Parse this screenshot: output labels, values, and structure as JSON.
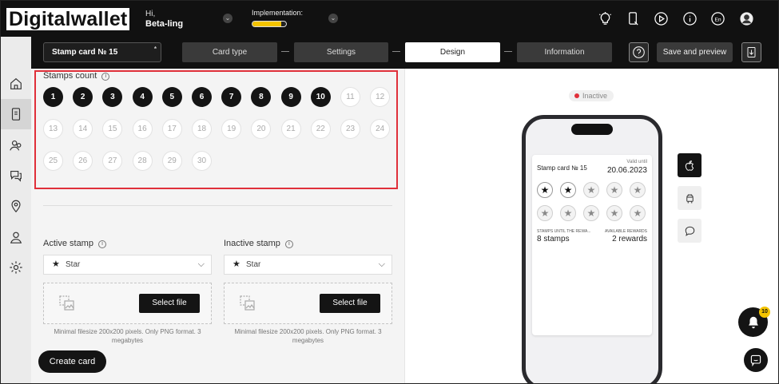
{
  "header": {
    "logo": "Digitalwallet",
    "greeting": "Hi,",
    "user_name": "Beta-ling",
    "implementation_label": "Implementation:",
    "implementation_progress": 0.85,
    "language": "En",
    "icons": [
      "lightbulb-icon",
      "phone-icon",
      "play-icon",
      "info-icon",
      "language-icon",
      "avatar"
    ]
  },
  "sidebar": {
    "items": [
      "home-icon",
      "card-icon",
      "users-icon",
      "chat-icon",
      "location-icon",
      "user-icon",
      "settings-icon"
    ],
    "active_index": 1
  },
  "toolbar": {
    "card_name": "Stamp card № 15",
    "required_mark": "*",
    "steps": [
      "Card type",
      "Settings",
      "Design",
      "Information"
    ],
    "active_step": "Design",
    "save_label": "Save and preview"
  },
  "stamps": {
    "title": "Stamps count",
    "selected": 10,
    "numbers": [
      "1",
      "2",
      "3",
      "4",
      "5",
      "6",
      "7",
      "8",
      "9",
      "10",
      "11",
      "12",
      "13",
      "14",
      "15",
      "16",
      "17",
      "18",
      "19",
      "20",
      "21",
      "22",
      "23",
      "24",
      "25",
      "26",
      "27",
      "28",
      "29",
      "30"
    ]
  },
  "active_stamp": {
    "label": "Active stamp",
    "value": "Star",
    "button": "Select file",
    "hint": "Minimal filesize 200x200 pixels. Only PNG format. 3 megabytes"
  },
  "inactive_stamp": {
    "label": "Inactive stamp",
    "value": "Star",
    "button": "Select file",
    "hint": "Minimal filesize 200x200 pixels. Only PNG format. 3 megabytes"
  },
  "create_label": "Create card",
  "preview": {
    "status": "Inactive",
    "status_color": "#e0303a",
    "card_title": "Stamp card № 15",
    "valid_label": "Valid until",
    "valid_date": "20.06.2023",
    "filled_stamps": 2,
    "total_stamps": 10,
    "left_caption": "STAMPS UNTIL THE REWA...",
    "left_value": "8 stamps",
    "right_caption": "AVAILABLE REWARDS",
    "right_value": "2 rewards",
    "platforms": [
      "apple-icon",
      "android-icon",
      "chat-bubble-icon"
    ]
  },
  "notifications": {
    "count": "10"
  },
  "colors": {
    "accent": "#f4c400",
    "dark": "#141414",
    "highlight": "#e0303a"
  }
}
